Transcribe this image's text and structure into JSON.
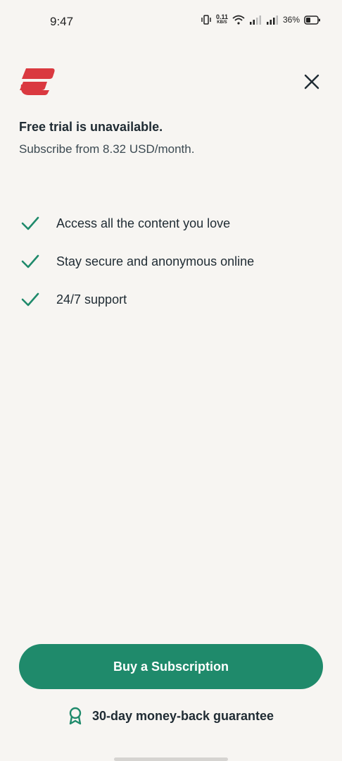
{
  "status_bar": {
    "time": "9:47",
    "net_speed": "0.11",
    "net_unit": "KB/S",
    "battery": "36%",
    "icons": [
      "vibrate-icon",
      "wifi-icon",
      "signal-icon",
      "signal-icon",
      "battery-icon"
    ]
  },
  "header": {
    "logo": "expressvpn-logo",
    "close_icon": "close-icon"
  },
  "message": {
    "title": "Free trial is unavailable.",
    "subtitle": "Subscribe from 8.32 USD/month."
  },
  "features": [
    {
      "label": "Access all the content you love",
      "icon": "check-icon"
    },
    {
      "label": "Stay secure and anonymous online",
      "icon": "check-icon"
    },
    {
      "label": "24/7 support",
      "icon": "check-icon"
    }
  ],
  "cta": {
    "buy_label": "Buy a Subscription"
  },
  "guarantee": {
    "label": "30-day money-back guarantee",
    "icon": "award-ribbon-icon"
  },
  "colors": {
    "background": "#f7f5f2",
    "accent": "#1f8a6b",
    "brand_red": "#da3940",
    "text": "#1f2b33"
  }
}
